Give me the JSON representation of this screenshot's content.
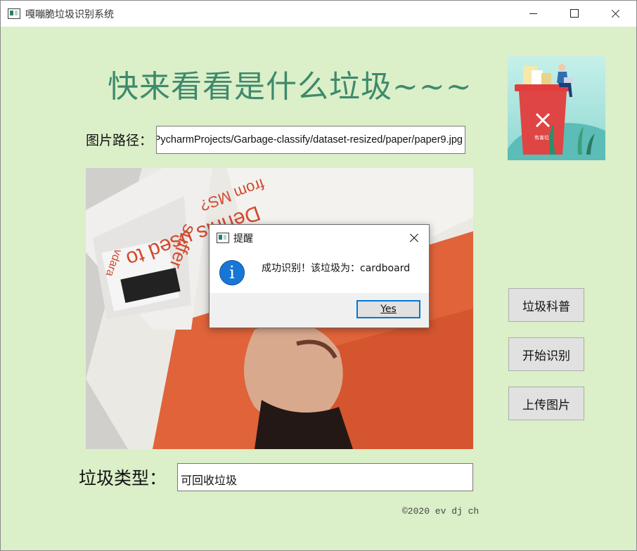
{
  "window": {
    "title": "嘎嘣脆垃圾识别系统"
  },
  "main": {
    "headline": "快来看看是什么垃圾~~~",
    "path_label": "图片路径：",
    "path_value": "/PycharmProjects/Garbage-classify/dataset-resized/paper/paper9.jpg",
    "type_label": "垃圾类型：",
    "type_value": "可回收垃圾",
    "copyright": "©2020 ev dj ch"
  },
  "buttons": {
    "science": "垃圾科普",
    "identify": "开始识别",
    "upload": "上传图片"
  },
  "dialog": {
    "title": "提醒",
    "message": "成功识别！该垃圾为：cardboard",
    "yes": "Yes",
    "icon": "info-icon"
  },
  "photo_texts": {
    "headline": "Dennis used to",
    "sub": "from MS?",
    "suffer": "suffer",
    "brand": "vdara"
  },
  "logo_texts": {
    "bin_label": "有害垃圾"
  },
  "colors": {
    "background": "#dbefc8",
    "headline": "#3d8a6c",
    "dialog_accent": "#0078d7",
    "info_icon": "#1877d6"
  }
}
